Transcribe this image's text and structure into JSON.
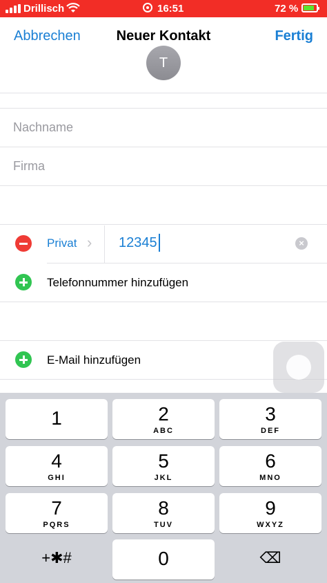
{
  "status": {
    "carrier": "Drillisch",
    "time": "16:51",
    "battery": "72 %"
  },
  "nav": {
    "cancel": "Abbrechen",
    "title": "Neuer Kontakt",
    "done": "Fertig"
  },
  "avatar_initial": "T",
  "fields": {
    "last_name_placeholder": "Nachname",
    "company_placeholder": "Firma"
  },
  "phone": {
    "type_label": "Privat",
    "value": "12345",
    "clear_symbol": "×"
  },
  "actions": {
    "add_phone": "Telefonnummer hinzufügen",
    "add_email": "E-Mail hinzufügen"
  },
  "keypad": {
    "keys": [
      {
        "digit": "1",
        "letters": ""
      },
      {
        "digit": "2",
        "letters": "ABC"
      },
      {
        "digit": "3",
        "letters": "DEF"
      },
      {
        "digit": "4",
        "letters": "GHI"
      },
      {
        "digit": "5",
        "letters": "JKL"
      },
      {
        "digit": "6",
        "letters": "MNO"
      },
      {
        "digit": "7",
        "letters": "PQRS"
      },
      {
        "digit": "8",
        "letters": "TUV"
      },
      {
        "digit": "9",
        "letters": "WXYZ"
      },
      {
        "digit": "0",
        "letters": ""
      }
    ],
    "symbols_key": "+✱#",
    "delete_symbol": "⌫"
  },
  "colors": {
    "status_bar": "#f22d26",
    "accent": "#1a7fd4",
    "remove": "#ef3b35",
    "add": "#31c552"
  }
}
